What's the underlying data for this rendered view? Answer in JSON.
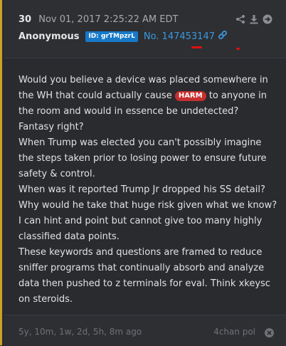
{
  "post": {
    "number": "30",
    "timestamp": "Nov 01, 2017 2:25:22 AM EDT",
    "author": "Anonymous",
    "id_badge": "ID: grTMpzrL",
    "post_link": "No. 147453147"
  },
  "body": {
    "line1_before": "Would you believe a device was placed somewhere in the WH that could actually cause ",
    "highlight": "HARM",
    "line1_after": " to anyone in the room and would in essence be undetected?",
    "lines": [
      "Fantasy right?",
      "When Trump was elected you can't possibly imagine the steps taken prior to losing power to ensure future safety & control.",
      "When was it reported Trump Jr dropped his SS detail?",
      "Why would he take that huge risk given what we know?",
      "I can hint and point but cannot give too many highly classified data points.",
      "These keywords and questions are framed to reduce sniffer programs that continually absorb and analyze data then pushed to z terminals for eval. Think xkeysc on steroids."
    ]
  },
  "footer": {
    "age": "5y, 10m, 1w, 2d, 5h, 8m ago",
    "source": "4chan pol"
  },
  "icons": {
    "share": "share-icon",
    "download": "download-icon",
    "go": "arrow-right-circle-icon",
    "link": "link-icon",
    "close": "close-circle-icon"
  },
  "colors": {
    "accent_border": "#c9a227",
    "id_badge": "#1779c8",
    "link": "#3a98df",
    "highlight": "#c62f2f",
    "annotation_marks": "#e01010"
  }
}
